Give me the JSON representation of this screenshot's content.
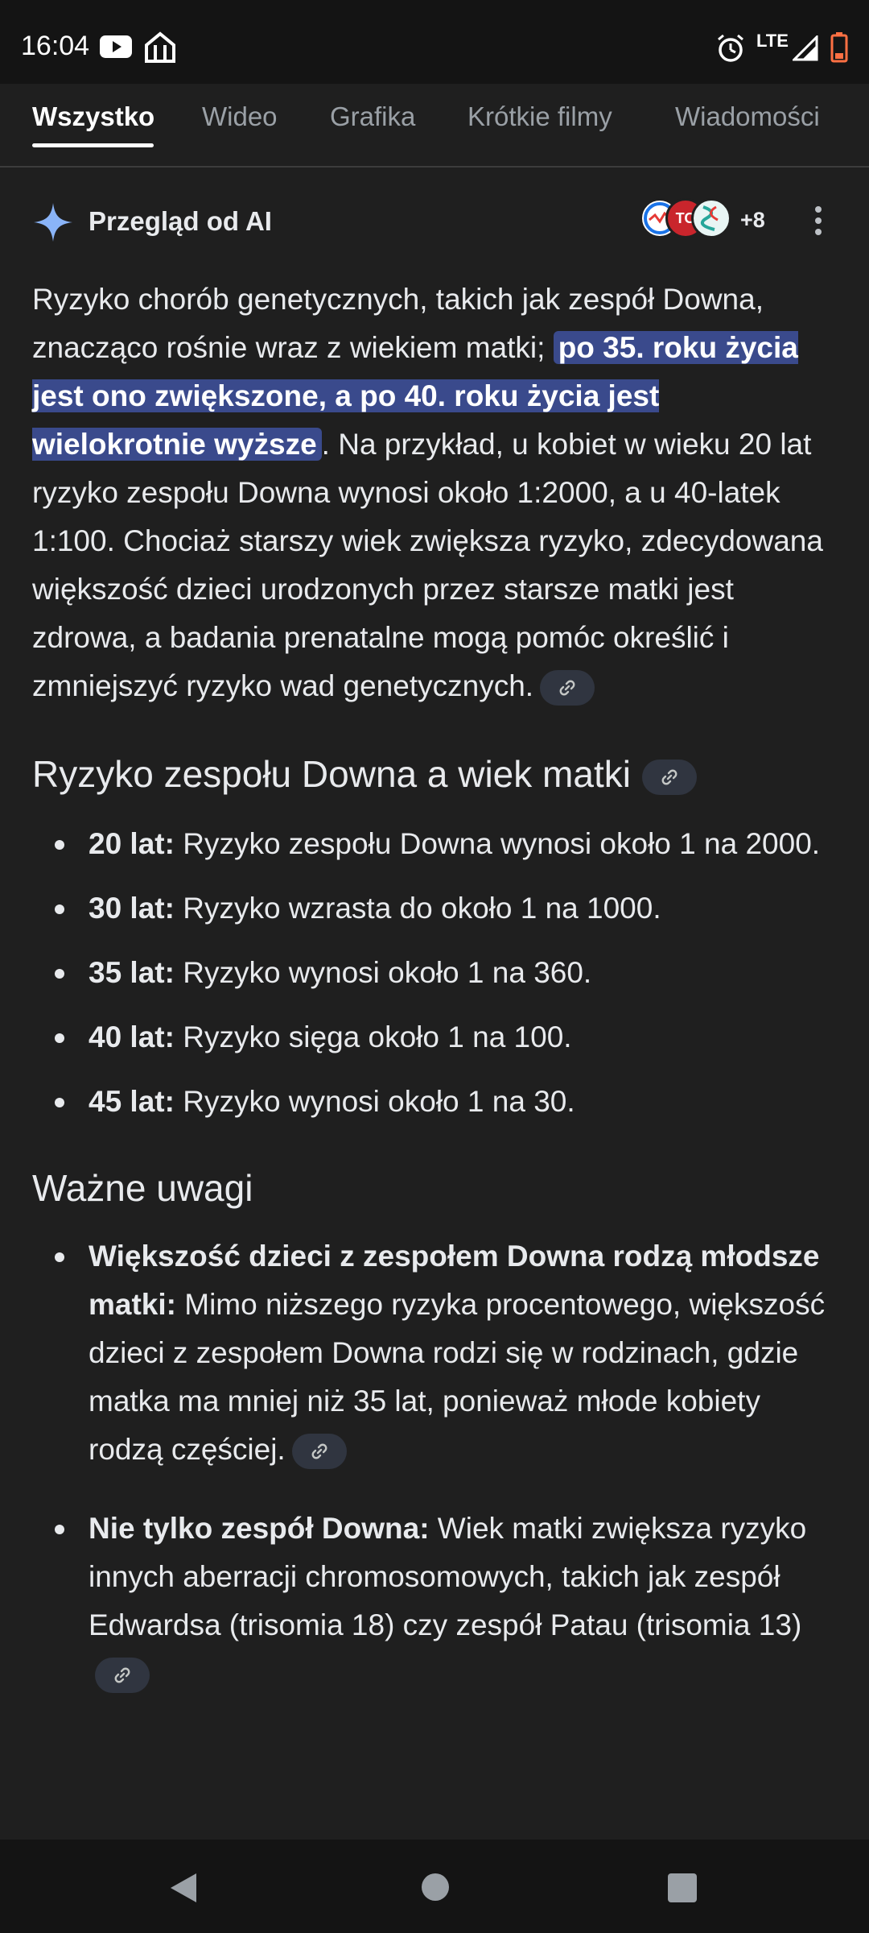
{
  "status": {
    "time": "16:04",
    "network": "LTE"
  },
  "tabs": [
    {
      "label": "Wszystko",
      "active": true
    },
    {
      "label": "Wideo"
    },
    {
      "label": "Grafika"
    },
    {
      "label": "Krótkie filmy"
    },
    {
      "label": "Wiadomości"
    }
  ],
  "ai": {
    "title": "Przegląd od AI",
    "source_badge": "TO",
    "sources_more": "+8"
  },
  "intro": {
    "text_before": "Ryzyko chorób genetycznych, takich jak zespół Downa, znacząco rośnie wraz z wiekiem matki; ",
    "highlight": "po 35. roku życia jest ono zwiększone, a po 40. roku życia jest wielokrotnie wyższe",
    "text_after": ". Na przykład, u kobiet w wieku 20 lat ryzyko zespołu Downa wynosi około 1:2000, a u 40-latek 1:100. Chociaż starszy wiek zwiększa ryzyko, zdecydowana większość dzieci urodzonych przez starsze matki jest zdrowa, a badania prenatalne mogą pomóc określić i zmniejszyć ryzyko wad genetycznych."
  },
  "section1": {
    "heading": "Ryzyko zespołu Downa a wiek matki",
    "items": [
      {
        "label": "20 lat:",
        "text": " Ryzyko zespołu Downa wynosi około 1 na 2000."
      },
      {
        "label": "30 lat:",
        "text": " Ryzyko wzrasta do około 1 na 1000."
      },
      {
        "label": "35 lat:",
        "text": " Ryzyko wynosi około 1 na 360."
      },
      {
        "label": "40 lat:",
        "text": " Ryzyko sięga około 1 na 100."
      },
      {
        "label": "45 lat:",
        "text": " Ryzyko wynosi około 1 na 30."
      }
    ]
  },
  "section2": {
    "heading": "Ważne uwagi",
    "items": [
      {
        "label": "Większość dzieci z zespołem Downa rodzą młodsze matki:",
        "text": " Mimo niższego ryzyka procentowego, większość dzieci z zespołem Downa rodzi się w rodzinach, gdzie matka ma mniej niż 35 lat, ponieważ młode kobiety rodzą częściej."
      },
      {
        "label": "Nie tylko zespół Downa:",
        "text": " Wiek matki zwiększa ryzyko innych aberracji chromosomowych, takich jak zespół Edwardsa (trisomia 18) czy zespół Patau (trisomia 13)"
      }
    ]
  },
  "colors": {
    "background": "#1f1f1f",
    "highlight": "#3a4a8c",
    "accent_sparkle": "#8ab4f8"
  }
}
